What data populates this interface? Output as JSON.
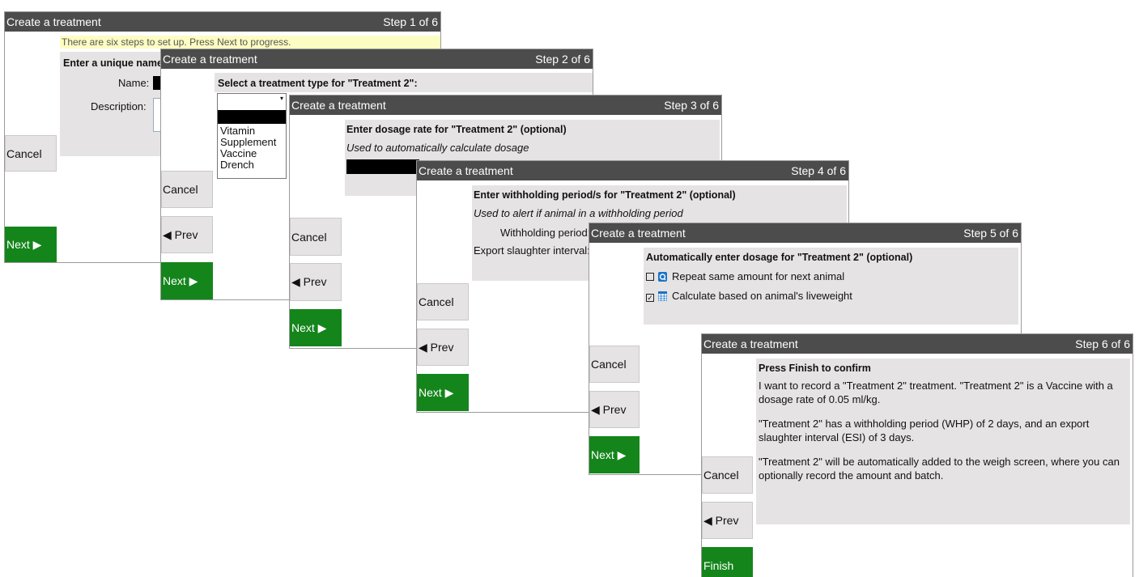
{
  "windows": [
    {
      "title": "Create a treatment",
      "step": "Step 1 of 6",
      "hint": "There are six steps to set up. Press Next to progress.",
      "heading": "Enter a unique name",
      "name_label": "Name:",
      "description_label": "Description:",
      "cancel": "Cancel",
      "next": "Next ▶"
    },
    {
      "title": "Create a treatment",
      "step": "Step 2 of 6",
      "heading": "Select a treatment type for \"Treatment 2\":",
      "options": [
        "Vitamin",
        "Supplement",
        "Vaccine",
        "Drench"
      ],
      "cancel": "Cancel",
      "prev": "◀ Prev",
      "next": "Next ▶"
    },
    {
      "title": "Create a treatment",
      "step": "Step 3 of 6",
      "heading": "Enter dosage rate for \"Treatment 2\" (optional)",
      "subtitle": "Used to automatically calculate dosage",
      "cancel": "Cancel",
      "prev": "◀ Prev",
      "next": "Next ▶"
    },
    {
      "title": "Create a treatment",
      "step": "Step 4 of 6",
      "heading": "Enter withholding period/s for \"Treatment 2\" (optional)",
      "subtitle": "Used to alert if animal in a withholding period",
      "withholding_label": "Withholding period:",
      "export_label": "Export slaughter interval:",
      "cancel": "Cancel",
      "prev": "◀ Prev",
      "next": "Next ▶"
    },
    {
      "title": "Create a treatment",
      "step": "Step 5 of 6",
      "heading": "Automatically enter dosage for \"Treatment 2\" (optional)",
      "option1": "Repeat same amount for next animal",
      "option1_checked": false,
      "option2": "Calculate based on animal's liveweight",
      "option2_checked": true,
      "cancel": "Cancel",
      "prev": "◀ Prev",
      "next": "Next ▶"
    },
    {
      "title": "Create a treatment",
      "step": "Step 6 of 6",
      "heading": "Press Finish to confirm",
      "p1": "I want to record a \"Treatment 2\" treatment. \"Treatment 2\" is a Vaccine with a dosage rate of 0.05 ml/kg.",
      "p2": "\"Treatment 2\" has a withholding period (WHP) of 2 days, and an export slaughter interval (ESI) of 3 days.",
      "p3": "\"Treatment 2\" will be automatically added to the weigh screen, where you can optionally record the amount and batch.",
      "cancel": "Cancel",
      "prev": "◀ Prev",
      "finish": "Finish"
    }
  ],
  "colors": {
    "titlebar": "#4c4c4c",
    "panel": "#e6e3e4",
    "hint": "#fcfdc2",
    "go": "#14851b"
  }
}
